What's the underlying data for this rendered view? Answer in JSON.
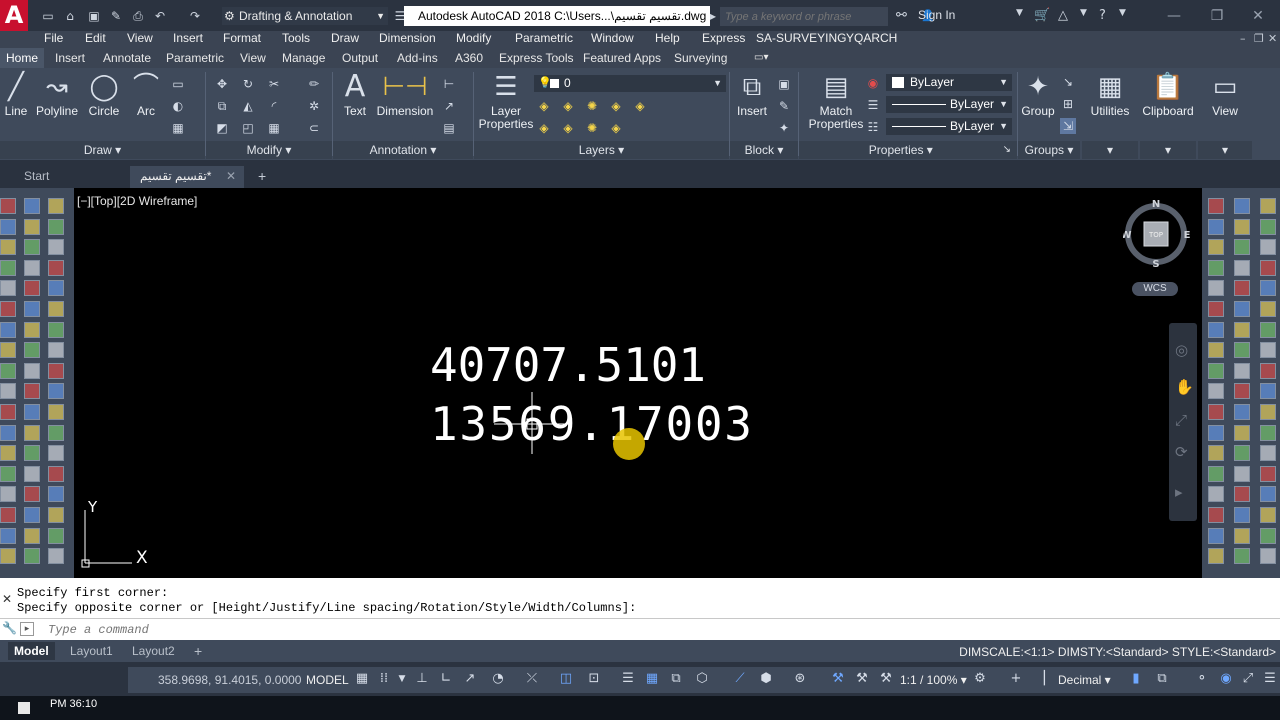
{
  "titlebar": {
    "logo": "A",
    "workspace": "Drafting & Annotation",
    "title": "Autodesk AutoCAD 2018   C:\\Users...\\تقسيم تقسيم.dwg",
    "search_placeholder": "Type a keyword or phrase",
    "sign_in": "Sign In"
  },
  "menubar": {
    "items": [
      "File",
      "Edit",
      "View",
      "Insert",
      "Format",
      "Tools",
      "Draw",
      "Dimension",
      "Modify",
      "Parametric",
      "Window",
      "Help",
      "Express",
      "SA-SURVEYING",
      "YQARCH"
    ]
  },
  "ribbon_tabs": [
    "Home",
    "Insert",
    "Annotate",
    "Parametric",
    "View",
    "Manage",
    "Output",
    "Add-ins",
    "A360",
    "Express Tools",
    "Featured Apps",
    "Surveying"
  ],
  "ribbon": {
    "draw": {
      "title": "Draw",
      "tools": [
        "Line",
        "Polyline",
        "Circle",
        "Arc"
      ]
    },
    "modify": {
      "title": "Modify"
    },
    "annotation": {
      "title": "Annotation",
      "text": "Text",
      "dimension": "Dimension"
    },
    "layers": {
      "title": "Layers",
      "layer_properties": "Layer Properties",
      "current_layer": "0"
    },
    "block": {
      "title": "Block",
      "insert": "Insert"
    },
    "properties": {
      "title": "Properties",
      "match": "Match Properties",
      "color": "ByLayer",
      "linetype": "ByLayer",
      "lineweight": "ByLayer"
    },
    "groups": {
      "title": "Groups",
      "group": "Group"
    },
    "utilities": "Utilities",
    "clipboard": "Clipboard",
    "view": "View"
  },
  "doc_tabs": {
    "start": "Start",
    "file": "تقسيم تقسيم*"
  },
  "viewport": {
    "label": "[−][Top][2D Wireframe]",
    "text1": "40707.5101",
    "text2": "13569.17003",
    "viewcube": {
      "n": "N",
      "s": "S",
      "e": "E",
      "w": "W",
      "face": "TOP"
    },
    "wcs": "WCS",
    "ucs_x": "X",
    "ucs_y": "Y"
  },
  "command": {
    "history": [
      "Specify first corner:",
      "Specify opposite corner or [Height/Justify/Line spacing/Rotation/Style/Width/Columns]:"
    ],
    "placeholder": "Type a command"
  },
  "layout_tabs": [
    "Model",
    "Layout1",
    "Layout2"
  ],
  "dim_info": "DIMSCALE:<1:1> DIMSTY:<Standard> STYLE:<Standard>",
  "status": {
    "coords": "358.9698, 91.4015, 0.0000",
    "model": "MODEL",
    "scale": "1:1 / 100%",
    "units": "Decimal"
  },
  "taskbar": {
    "clock": "PM 36:10"
  }
}
